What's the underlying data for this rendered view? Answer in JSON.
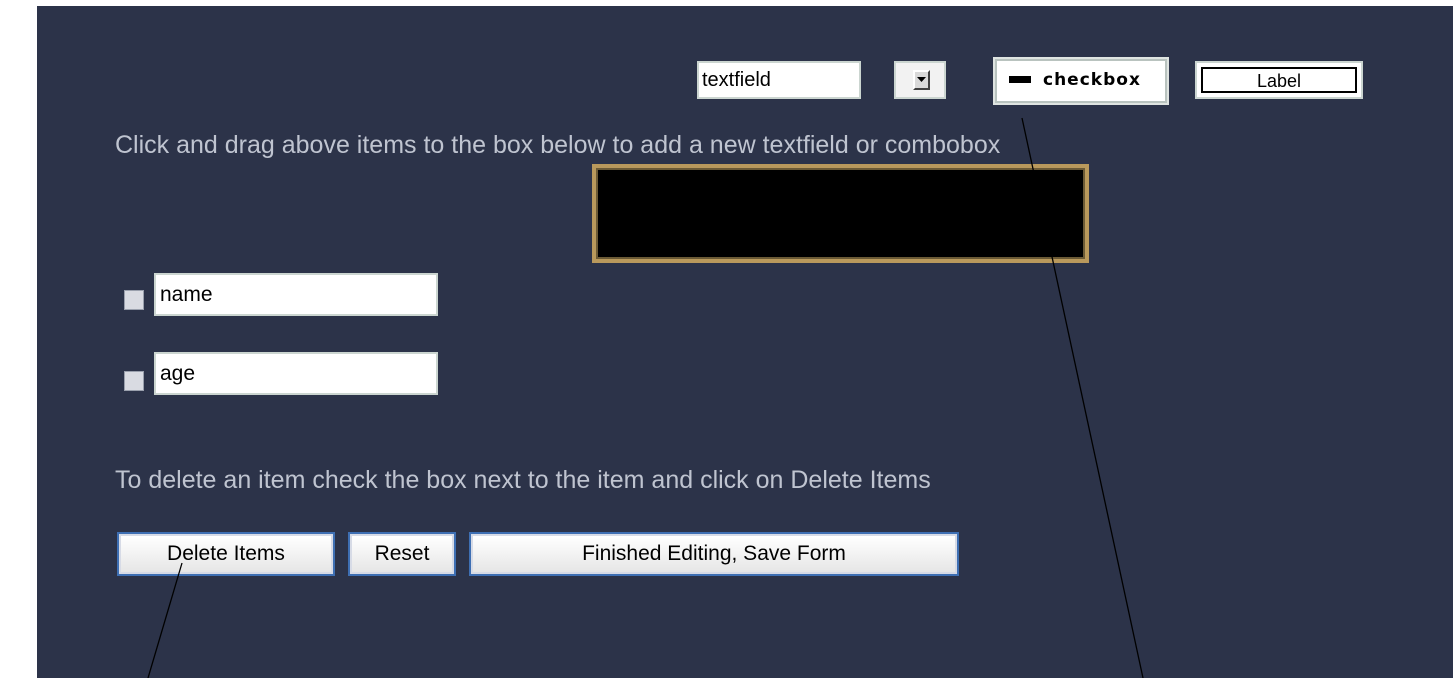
{
  "palette": {
    "textfield_label": "textfield",
    "checkbox_label": "checkbox",
    "label_label": "Label"
  },
  "instructions": {
    "drag": "Click and drag above items to the box below to add a new textfield or combobox",
    "delete": "To delete an item check the box next to the item and click on Delete Items"
  },
  "form_fields": [
    {
      "value": "name",
      "checked": false
    },
    {
      "value": "age",
      "checked": false
    }
  ],
  "buttons": {
    "delete": "Delete Items",
    "reset": "Reset",
    "save": "Finished Editing, Save Form"
  },
  "colors": {
    "background": "#2c3349",
    "instruction_text": "#bfc4d0",
    "drop_box_border": "#b9995c",
    "button_outline": "#3e6fb3"
  }
}
